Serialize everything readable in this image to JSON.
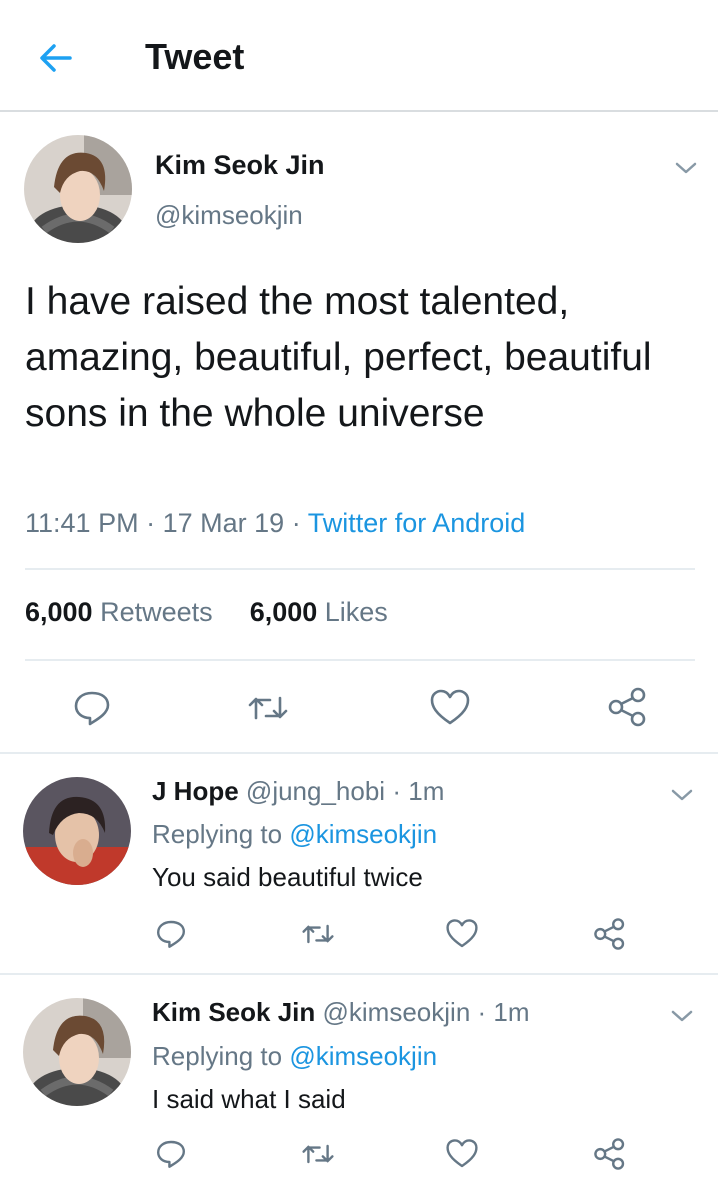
{
  "header": {
    "title": "Tweet",
    "back_icon": "back-arrow-icon",
    "accent_color": "#1da1f2"
  },
  "main_tweet": {
    "author_name": "Kim Seok Jin",
    "handle": "@kimseokjin",
    "text": "I have raised the most talented, amazing, beautiful, perfect, beautiful sons in the whole universe",
    "time": "11:41 PM",
    "date": "17 Mar 19",
    "separator": "·",
    "source": "Twitter for Android",
    "retweet_count": "6,000",
    "retweet_label": "Retweets",
    "like_count": "6,000",
    "like_label": "Likes",
    "actions": [
      "reply-icon",
      "retweet-icon",
      "like-icon",
      "share-icon"
    ]
  },
  "replies": [
    {
      "author_name": "J Hope",
      "handle": "@jung_hobi",
      "separator": "·",
      "time_ago": "1m",
      "replying_prefix": "Replying to",
      "replying_to": "@kimseokjin",
      "text": "You said beautiful twice"
    },
    {
      "author_name": "Kim Seok Jin",
      "handle": "@kimseokjin",
      "separator": "·",
      "time_ago": "1m",
      "replying_prefix": "Replying to",
      "replying_to": "@kimseokjin",
      "text": "I said what I said"
    }
  ]
}
